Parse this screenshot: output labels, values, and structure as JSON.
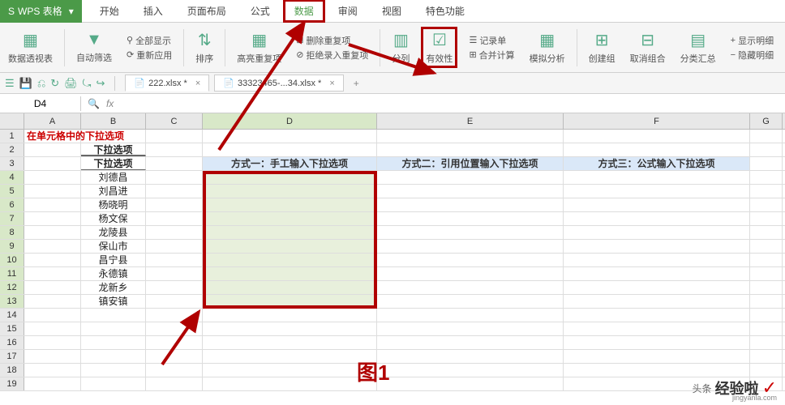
{
  "app": {
    "name": "WPS 表格",
    "dropdown": "▾"
  },
  "menu": {
    "items": [
      "开始",
      "插入",
      "页面布局",
      "公式",
      "数据",
      "审阅",
      "视图",
      "特色功能"
    ],
    "active_index": 4
  },
  "ribbon": {
    "pivot": "数据透视表",
    "autofilter": "自动筛选",
    "showall": "全部显示",
    "reapply": "重新应用",
    "sort": "排序",
    "highlight": "高亮重复项",
    "deldup": "删除重复项",
    "rejectdup": "拒绝录入重复项",
    "splitcol": "分列",
    "validity": "有效性",
    "consolidate": "合并计算",
    "record": "记录单",
    "whatif": "模拟分析",
    "group": "创建组",
    "ungroup": "取消组合",
    "subtotal": "分类汇总",
    "showdetail": "显示明细",
    "hidedetail": "隐藏明细"
  },
  "qat": {
    "icons": [
      "☰",
      "💾",
      "⎌",
      "↻",
      "🖨",
      "⤿",
      "↪"
    ]
  },
  "doctabs": [
    {
      "icon": "📄",
      "name": "222.xlsx *"
    },
    {
      "icon": "📄",
      "name": "33323465-...34.xlsx *"
    }
  ],
  "namebox": "D4",
  "fx": "fx",
  "sheet": {
    "cols": [
      "A",
      "B",
      "C",
      "D",
      "E",
      "F",
      "G"
    ],
    "title_row1": "在单元格中的下拉选项",
    "b2": "下拉选项",
    "b3": "下拉选项",
    "d3": "方式一：手工输入下拉选项",
    "e3": "方式二：引用位置输入下拉选项",
    "f3": "方式三：公式输入下拉选项",
    "names": [
      "刘德昌",
      "刘昌进",
      "杨晓明",
      "杨文保",
      "龙陵县",
      "保山市",
      "昌宁县",
      "永德镇",
      "龙新乡",
      "镇安镇"
    ]
  },
  "figure_label": "图1",
  "watermark": {
    "brand": "头条",
    "text": "经验啦",
    "check": "✓",
    "url": "jingyanla.com"
  }
}
